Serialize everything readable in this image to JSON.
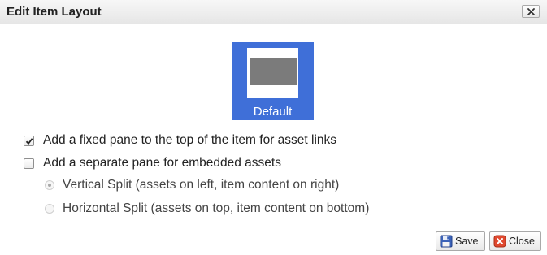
{
  "dialog": {
    "title": "Edit Item Layout",
    "close_icon": "close-x-icon"
  },
  "layout_option": {
    "label": "Default",
    "selected": true,
    "colors": {
      "tile_background": "#3f6fd8",
      "pane": "#7b7b7b"
    }
  },
  "options": {
    "fixed_pane": {
      "label": "Add a fixed pane to the top of the item for asset links",
      "checked": true
    },
    "separate_pane": {
      "label": "Add a separate pane for embedded assets",
      "checked": false
    },
    "vertical_split": {
      "label": "Vertical Split (assets on left, item content on right)",
      "selected": true,
      "disabled": true
    },
    "horizontal_split": {
      "label": "Horizontal Split (assets on top, item content on bottom)",
      "selected": false,
      "disabled": true
    }
  },
  "buttons": {
    "save": {
      "label": "Save",
      "icon": "floppy-disk-icon"
    },
    "close": {
      "label": "Close",
      "icon": "red-x-icon"
    }
  }
}
